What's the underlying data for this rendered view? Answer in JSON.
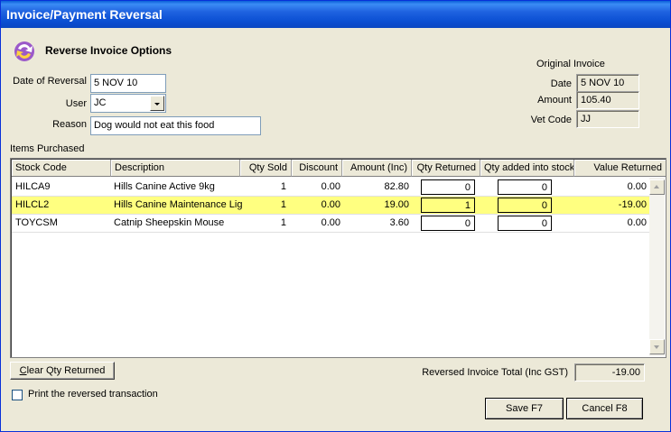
{
  "window": {
    "title": "Invoice/Payment Reversal"
  },
  "header": {
    "title": "Reverse Invoice Options",
    "icon": "refresh-icon"
  },
  "form": {
    "date_label": "Date of Reversal",
    "date_value": "5 NOV 10",
    "user_label": "User",
    "user_value": "JC",
    "reason_label": "Reason",
    "reason_value": "Dog would not eat this food"
  },
  "original_invoice": {
    "heading": "Original Invoice",
    "date_label": "Date",
    "date_value": "5 NOV 10",
    "amount_label": "Amount",
    "amount_value": "105.40",
    "vet_label": "Vet Code",
    "vet_value": "JJ"
  },
  "items": {
    "label": "Items Purchased",
    "columns": [
      "Stock Code",
      "Description",
      "Qty Sold",
      "Discount",
      "Amount (Inc)",
      "Qty Returned",
      "Qty added into stock",
      "Value Returned"
    ],
    "rows": [
      {
        "code": "HILCA9",
        "description": "Hills Canine Active 9kg",
        "qty_sold": "1",
        "discount": "0.00",
        "amount": "82.80",
        "qty_returned": "0",
        "qty_stock": "0",
        "value_returned": "0.00",
        "selected": false
      },
      {
        "code": "HILCL2",
        "description": "Hills Canine Maintenance Ligh",
        "qty_sold": "1",
        "discount": "0.00",
        "amount": "19.00",
        "qty_returned": "1",
        "qty_stock": "0",
        "value_returned": "-19.00",
        "selected": true
      },
      {
        "code": "TOYCSM",
        "description": "Catnip Sheepskin Mouse",
        "qty_sold": "1",
        "discount": "0.00",
        "amount": "3.60",
        "qty_returned": "0",
        "qty_stock": "0",
        "value_returned": "0.00",
        "selected": false
      }
    ]
  },
  "footer": {
    "clear_button": "Clear Qty Returned",
    "total_label": "Reversed Invoice Total (Inc GST)",
    "total_value": "-19.00",
    "print_checkbox_label": "Print the reversed transaction",
    "print_checked": false,
    "save_button": "Save F7",
    "cancel_button": "Cancel F8"
  },
  "colors": {
    "titlebar": "#0a5fd8",
    "highlight_row": "#ffff80",
    "window_bg": "#ece9d8"
  }
}
